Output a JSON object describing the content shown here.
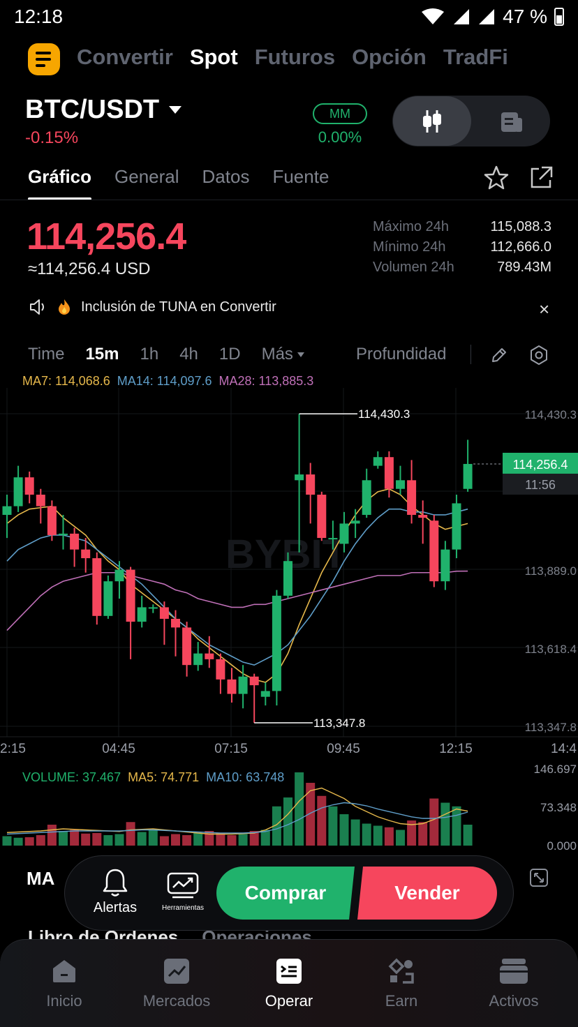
{
  "status": {
    "time": "12:18",
    "battery": "47 %"
  },
  "topnav": {
    "items": [
      "Convertir",
      "Spot",
      "Futuros",
      "Opción",
      "TradFi"
    ],
    "active": "Spot"
  },
  "pair": {
    "name": "BTC/USDT",
    "change": "-0.15%",
    "mm_label": "MM",
    "mm_value": "0.00%"
  },
  "subtabs": {
    "items": [
      "Gráfico",
      "General",
      "Datos",
      "Fuente"
    ],
    "active": "Gráfico"
  },
  "price": {
    "last": "114,256.4",
    "usd": "≈114,256.4 USD"
  },
  "stats": [
    {
      "label": "Máximo 24h",
      "value": "115,088.3"
    },
    {
      "label": "Mínimo 24h",
      "value": "112,666.0"
    },
    {
      "label": "Volumen 24h",
      "value": "789.43M"
    }
  ],
  "announcement": {
    "text": "Inclusión de TUNA en Convertir",
    "close": "×"
  },
  "intervals": {
    "items": [
      "Time",
      "15m",
      "1h",
      "4h",
      "1D"
    ],
    "active": "15m",
    "more": "Más",
    "depth": "Profundidad"
  },
  "ma_legend": {
    "ma7": "MA7: 114,068.6",
    "ma14": "MA14: 114,097.6",
    "ma28": "MA28: 113,885.3"
  },
  "volume_legend": {
    "volume": "VOLUME: 37.467",
    "ma5": "MA5: 74.771",
    "ma10": "MA10: 63.748"
  },
  "watermark": "BYBIT",
  "colors": {
    "up": "#20b26c",
    "down": "#f6465d",
    "ma7": "#e6b84b",
    "ma14": "#5f9ec9",
    "ma28": "#c070b8",
    "brand": "#f7a600"
  },
  "chart_data": {
    "type": "candlestick",
    "y_axis_labels": [
      "114,430.3",
      "113,889.0",
      "113,618.4",
      "113,347.8"
    ],
    "x_axis_labels": [
      "2:15",
      "04:45",
      "07:15",
      "09:45",
      "12:15",
      "14:4"
    ],
    "ylim": [
      113347.8,
      114430.3
    ],
    "high_marker": "114,430.3",
    "low_marker": "113,347.8",
    "last_price_tag": "114,256.4",
    "countdown": "11:56",
    "volume_axis_labels": [
      "146.697",
      "73.348",
      "0.000"
    ],
    "candles": [
      {
        "o": 114080,
        "c": 114110,
        "h": 114150,
        "l": 114000
      },
      {
        "o": 114110,
        "c": 114210,
        "h": 114250,
        "l": 114090
      },
      {
        "o": 114210,
        "c": 114150,
        "h": 114230,
        "l": 114120
      },
      {
        "o": 114150,
        "c": 114110,
        "h": 114170,
        "l": 114050
      },
      {
        "o": 114110,
        "c": 114010,
        "h": 114130,
        "l": 113990
      },
      {
        "o": 114010,
        "c": 114015,
        "h": 114080,
        "l": 113960
      },
      {
        "o": 114015,
        "c": 113960,
        "h": 114035,
        "l": 113900
      },
      {
        "o": 113960,
        "c": 113930,
        "h": 114000,
        "l": 113880
      },
      {
        "o": 113930,
        "c": 113730,
        "h": 113950,
        "l": 113700
      },
      {
        "o": 113730,
        "c": 113850,
        "h": 113870,
        "l": 113720
      },
      {
        "o": 113850,
        "c": 113890,
        "h": 113920,
        "l": 113790
      },
      {
        "o": 113890,
        "c": 113710,
        "h": 113900,
        "l": 113580
      },
      {
        "o": 113710,
        "c": 113760,
        "h": 113800,
        "l": 113690
      },
      {
        "o": 113760,
        "c": 113760,
        "h": 113770,
        "l": 113740
      },
      {
        "o": 113760,
        "c": 113720,
        "h": 113780,
        "l": 113630
      },
      {
        "o": 113720,
        "c": 113690,
        "h": 113750,
        "l": 113590
      },
      {
        "o": 113690,
        "c": 113560,
        "h": 113710,
        "l": 113520
      },
      {
        "o": 113560,
        "c": 113600,
        "h": 113640,
        "l": 113540
      },
      {
        "o": 113600,
        "c": 113580,
        "h": 113660,
        "l": 113550
      },
      {
        "o": 113580,
        "c": 113510,
        "h": 113600,
        "l": 113460
      },
      {
        "o": 113510,
        "c": 113460,
        "h": 113550,
        "l": 113430
      },
      {
        "o": 113460,
        "c": 113520,
        "h": 113560,
        "l": 113410
      },
      {
        "o": 113520,
        "c": 113490,
        "h": 113530,
        "l": 113360
      },
      {
        "o": 113450,
        "c": 113470,
        "h": 113500,
        "l": 113420
      },
      {
        "o": 113470,
        "c": 113800,
        "h": 113820,
        "l": 113420
      },
      {
        "o": 113800,
        "c": 113920,
        "h": 113950,
        "l": 113790
      },
      {
        "o": 114200,
        "c": 114220,
        "h": 114430,
        "l": 113950
      },
      {
        "o": 114220,
        "c": 114150,
        "h": 114260,
        "l": 114050
      },
      {
        "o": 114150,
        "c": 114000,
        "h": 114160,
        "l": 113990
      },
      {
        "o": 114000,
        "c": 114000,
        "h": 114060,
        "l": 113960
      },
      {
        "o": 113980,
        "c": 114050,
        "h": 114090,
        "l": 113950
      },
      {
        "o": 114050,
        "c": 114060,
        "h": 114100,
        "l": 114000
      },
      {
        "o": 114080,
        "c": 114200,
        "h": 114240,
        "l": 114070
      },
      {
        "o": 114250,
        "c": 114280,
        "h": 114300,
        "l": 114240
      },
      {
        "o": 114280,
        "c": 114170,
        "h": 114300,
        "l": 114140
      },
      {
        "o": 114170,
        "c": 114200,
        "h": 114250,
        "l": 114150
      },
      {
        "o": 114200,
        "c": 114080,
        "h": 114270,
        "l": 114050
      },
      {
        "o": 114080,
        "c": 114070,
        "h": 114130,
        "l": 113980
      },
      {
        "o": 114060,
        "c": 113850,
        "h": 114080,
        "l": 113830
      },
      {
        "o": 113850,
        "c": 113960,
        "h": 113990,
        "l": 113820
      },
      {
        "o": 113960,
        "c": 114120,
        "h": 114150,
        "l": 113930
      },
      {
        "o": 114170,
        "c": 114256.4,
        "h": 114340,
        "l": 114160
      }
    ],
    "volumes": [
      18,
      15,
      16,
      20,
      40,
      28,
      30,
      23,
      24,
      20,
      22,
      45,
      26,
      30,
      18,
      22,
      20,
      24,
      28,
      24,
      20,
      22,
      28,
      30,
      75,
      92,
      140,
      120,
      95,
      75,
      60,
      50,
      42,
      38,
      35,
      30,
      48,
      45,
      90,
      82,
      75,
      40
    ],
    "ma7": [
      114050,
      114080,
      114100,
      114105,
      114110,
      114070,
      114040,
      114010,
      113960,
      113920,
      113890,
      113840,
      113810,
      113780,
      113750,
      113720,
      113690,
      113650,
      113620,
      113590,
      113560,
      113530,
      113510,
      113500,
      113530,
      113600,
      113700,
      113790,
      113880,
      113950,
      114020,
      114080,
      114130,
      114160,
      114170,
      114150,
      114110,
      114080,
      114050,
      114030,
      114040,
      114050
    ],
    "ma14": [
      113920,
      113960,
      113980,
      114000,
      114010,
      114010,
      114000,
      113990,
      113960,
      113930,
      113900,
      113870,
      113840,
      113800,
      113760,
      113720,
      113690,
      113660,
      113630,
      113610,
      113590,
      113570,
      113560,
      113580,
      113600,
      113630,
      113680,
      113730,
      113790,
      113850,
      113920,
      113980,
      114030,
      114070,
      114100,
      114100,
      114090,
      114090,
      114080,
      114080,
      114090,
      114100
    ],
    "ma28": [
      113680,
      113720,
      113760,
      113800,
      113830,
      113850,
      113860,
      113870,
      113880,
      113880,
      113880,
      113870,
      113860,
      113850,
      113840,
      113820,
      113810,
      113790,
      113780,
      113770,
      113760,
      113760,
      113770,
      113770,
      113780,
      113790,
      113800,
      113810,
      113820,
      113830,
      113840,
      113850,
      113860,
      113870,
      113870,
      113870,
      113880,
      113880,
      113880,
      113880,
      113885,
      113885.3
    ],
    "vol_ma5": [
      25,
      26,
      27,
      28,
      30,
      32,
      31,
      30,
      29,
      28,
      27,
      30,
      31,
      32,
      30,
      28,
      26,
      24,
      22,
      22,
      22,
      23,
      24,
      30,
      40,
      60,
      85,
      105,
      110,
      100,
      90,
      75,
      65,
      55,
      48,
      42,
      40,
      42,
      50,
      60,
      70,
      66
    ],
    "vol_ma10": [
      22,
      23,
      24,
      25,
      26,
      27,
      28,
      28,
      28,
      28,
      28,
      29,
      30,
      30,
      29,
      28,
      27,
      26,
      25,
      24,
      24,
      24,
      25,
      27,
      32,
      40,
      50,
      62,
      72,
      78,
      82,
      80,
      76,
      70,
      65,
      60,
      55,
      52,
      52,
      54,
      58,
      64
    ]
  },
  "actions": {
    "ma_label": "MA",
    "alerts": "Alertas",
    "tools": "Herramientas",
    "buy": "Comprar",
    "sell": "Vender"
  },
  "peek": {
    "orderbook": "Libro de Órdenes",
    "trades": "Operaciones"
  },
  "bottom_nav": {
    "items": [
      "Inicio",
      "Mercados",
      "Operar",
      "Earn",
      "Activos"
    ],
    "active": "Operar"
  }
}
